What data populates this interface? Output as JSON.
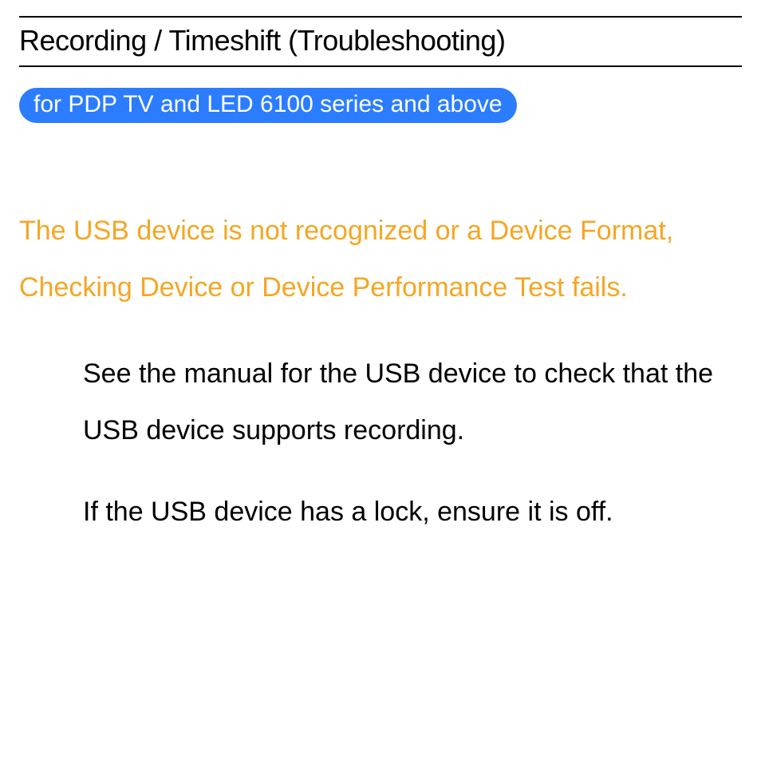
{
  "title": "Recording / Timeshift (Troubleshooting)",
  "badge": "for PDP TV and LED 6100 series and above",
  "issue_heading": "The USB device is not recognized or a Device Format, Checking Device or Device Performance Test fails.",
  "paragraphs": [
    "See the manual for the USB device to check that the USB device supports recording.",
    "If the USB device has a lock, ensure it is off."
  ]
}
